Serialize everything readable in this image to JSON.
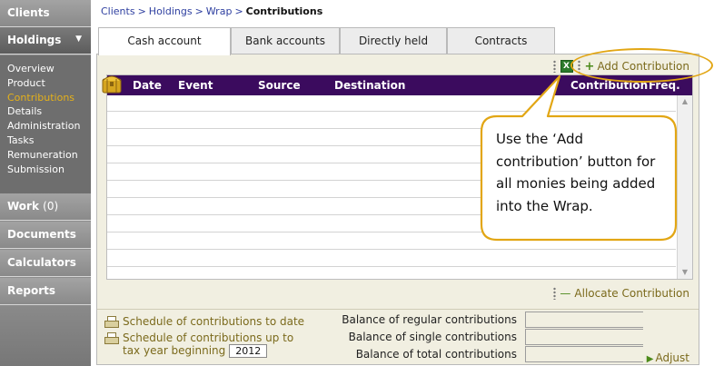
{
  "sidebar": {
    "clients": "Clients",
    "holdings": "Holdings",
    "holdings_caret": "▼",
    "sub_items": [
      "Overview",
      "Product",
      "Contributions",
      "Details",
      "Administration",
      "Tasks",
      "Remuneration",
      "Submission"
    ],
    "active_sub_item": "Contributions",
    "work": "Work",
    "work_count": "(0)",
    "documents": "Documents",
    "calculators": "Calculators",
    "reports": "Reports"
  },
  "breadcrumb": {
    "items": [
      "Clients",
      "Holdings",
      "Wrap"
    ],
    "separator": ">",
    "current": "Contributions"
  },
  "tabs": [
    "Cash account",
    "Bank accounts",
    "Directly held",
    "Contracts"
  ],
  "active_tab": "Cash account",
  "toolbar": {
    "excel_icon": "X",
    "add_contribution": "Add Contribution",
    "add_icon": "+"
  },
  "grid": {
    "columns": [
      "Date",
      "Event",
      "Source",
      "Destination",
      "Contribution",
      "Freq."
    ],
    "rows": []
  },
  "allocate_contribution": "Allocate Contribution",
  "schedule": {
    "to_date": "Schedule of contributions to date",
    "up_to_line1": "Schedule of contributions up to",
    "up_to_line2": "tax year beginning",
    "year": "2012"
  },
  "balances": {
    "regular_label": "Balance of regular contributions",
    "single_label": "Balance of single contributions",
    "total_label": "Balance of total contributions",
    "regular_value": "",
    "single_value": "",
    "total_value": ""
  },
  "adjust": "Adjust",
  "adjust_icon": "▶",
  "callout": {
    "text": "Use the ‘Add contribution’ button for all monies being added into the Wrap."
  },
  "colors": {
    "header_bg": "#3b0b5e",
    "accent": "#e2a614",
    "link": "#7b6a1c",
    "active_nav": "#e5b11a"
  }
}
